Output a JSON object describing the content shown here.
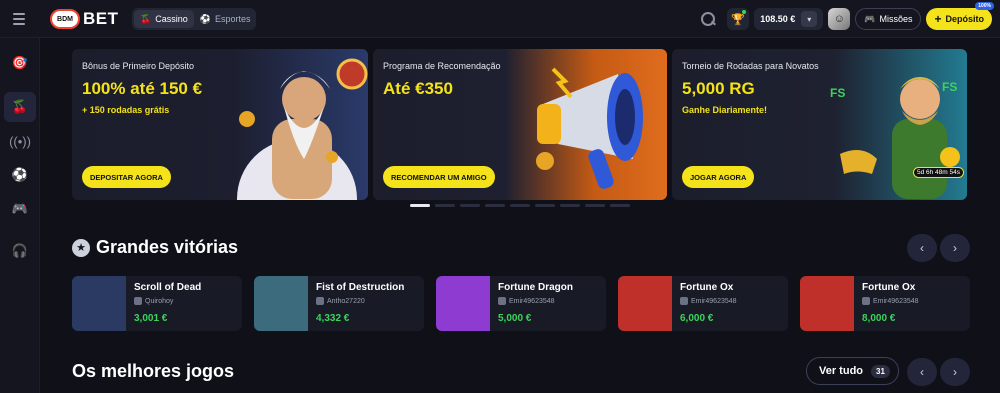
{
  "header": {
    "logo_badge": "BDM",
    "logo_text": "BET",
    "tabs": [
      {
        "label": "Cassino",
        "icon": "cherries-icon",
        "active": true
      },
      {
        "label": "Esportes",
        "icon": "soccer-ball-icon",
        "active": false
      }
    ],
    "balance": "108.50 €",
    "missions_label": "Missões",
    "deposit_label": "Depósito",
    "deposit_badge": "100%"
  },
  "sidebar": {
    "items": [
      {
        "name": "dart-target-icon",
        "active": false
      },
      {
        "name": "cherries-icon",
        "active": true
      },
      {
        "name": "live-broadcast-icon",
        "active": false
      },
      {
        "name": "soccer-ball-icon",
        "active": false
      },
      {
        "name": "gamepad-icon",
        "active": false
      },
      {
        "name": "headset-support-icon",
        "active": false
      }
    ]
  },
  "banners": [
    {
      "title": "Bônus de Primeiro Depósito",
      "amount": "100% até 150 €",
      "sub": "+ 150 rodadas grátis",
      "button": "DEPOSITAR AGORA"
    },
    {
      "title": "Programa de Recomendação",
      "amount": "Até €350",
      "sub": "",
      "button": "RECOMENDAR UM AMIGO"
    },
    {
      "title": "Torneio de Rodadas para Novatos",
      "amount": "5,000 RG",
      "sub": "Ganhe Diariamente!",
      "button": "JOGAR AGORA",
      "timer": "5d 6h 48m 54s"
    }
  ],
  "carousel": {
    "count": 9,
    "active_index": 0
  },
  "big_wins": {
    "title": "Grandes vitórias",
    "items": [
      {
        "game": "Scroll of Dead",
        "user": "Quirohoy",
        "amount": "3,001 €",
        "color": "#2b3a63"
      },
      {
        "game": "Fist of Destruction",
        "user": "Antho27220",
        "amount": "4,332 €",
        "color": "#3d6b7e"
      },
      {
        "game": "Fortune Dragon",
        "user": "Emir49623548",
        "amount": "5,000 €",
        "color": "#8e3bd1"
      },
      {
        "game": "Fortune Ox",
        "user": "Emir49623548",
        "amount": "6,000 €",
        "color": "#c0302b"
      },
      {
        "game": "Fortune Ox",
        "user": "Emir49623548",
        "amount": "8,000 €",
        "color": "#c0302b"
      }
    ]
  },
  "best_games": {
    "title": "Os melhores jogos",
    "view_all": "Ver tudo",
    "count": "31"
  },
  "colors": {
    "accent": "#f4e21a",
    "win_green": "#3bd45a",
    "background": "#0f1018"
  }
}
